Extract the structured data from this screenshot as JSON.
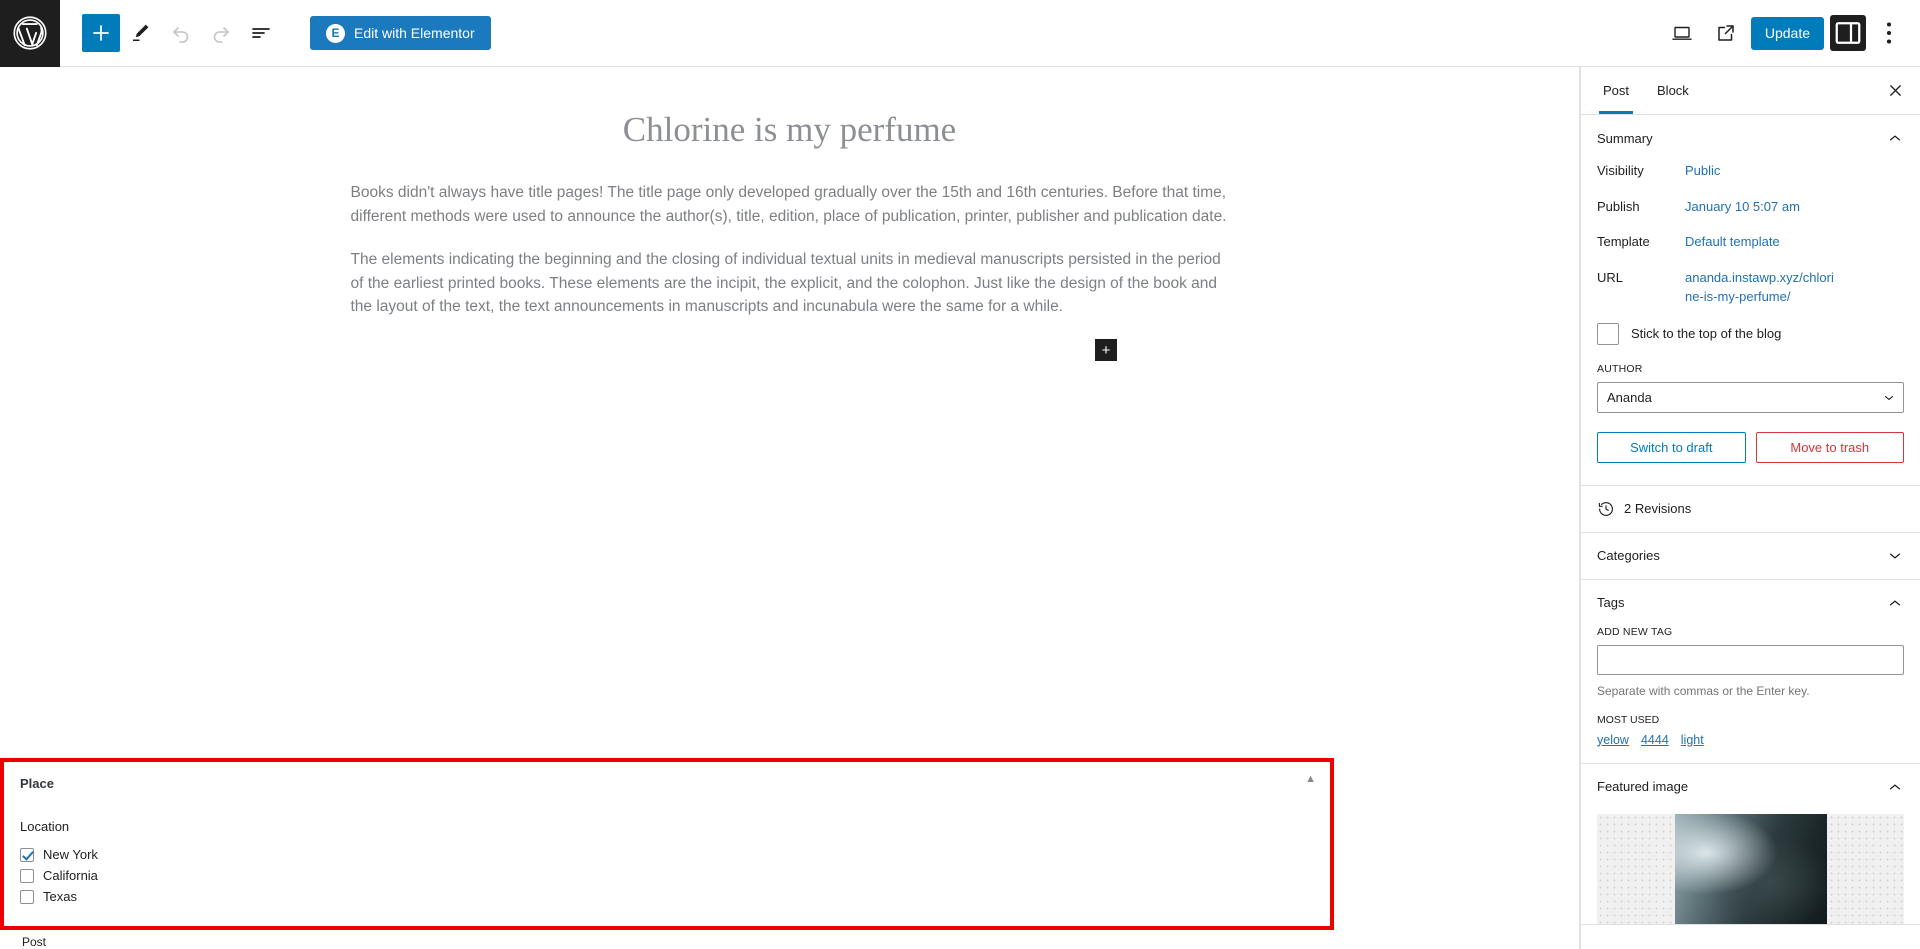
{
  "toolbar": {
    "logo_icon": "wordpress-logo-icon",
    "add_block_label": "+",
    "tools": [
      {
        "name": "add-block-button",
        "icon": "plus-icon"
      },
      {
        "name": "edit-tools-button",
        "icon": "pencil-icon"
      },
      {
        "name": "undo-button",
        "icon": "undo-arrow-icon"
      },
      {
        "name": "redo-button",
        "icon": "redo-arrow-icon"
      },
      {
        "name": "document-overview-button",
        "icon": "list-view-icon"
      }
    ],
    "elementor_label": "Edit with Elementor",
    "elementor_badge": "E",
    "preview_icon": "laptop-preview-icon",
    "view_icon": "external-link-icon",
    "update_label": "Update",
    "settings_icon": "sidebar-panel-icon",
    "options_icon": "more-options-icon"
  },
  "editor": {
    "title": "Chlorine is my perfume",
    "paragraph_1": "Books didn't always have title pages! The title page only developed gradually over the 15th and 16th centuries. Before that time, different methods were used to announce the author(s), title, edition, place of publication, printer, publisher and publication date.",
    "paragraph_2": "The elements indicating the beginning and the closing of individual textual units in medieval manuscripts persisted in the period of the earliest printed books. These elements are the incipit, the explicit, and the colophon. Just like the design of the book and the layout of the text, the text announcements in manuscripts and incunabula were the same for a while.",
    "inserter_label": "+"
  },
  "sidebar": {
    "tabs": [
      {
        "label": "Post",
        "active": true
      },
      {
        "label": "Block",
        "active": false
      }
    ],
    "close_icon": "close-icon",
    "summary": {
      "heading": "Summary",
      "rows": [
        {
          "label": "Visibility",
          "value": "Public"
        },
        {
          "label": "Publish",
          "value": "January 10 5:07 am"
        },
        {
          "label": "Template",
          "value": "Default template"
        },
        {
          "label": "URL",
          "value": "ananda.instawp.xyz/chlorine-is-my-perfume/"
        }
      ],
      "sticky_label": "Stick to the top of the blog",
      "sticky_checked": false,
      "author_label": "AUTHOR",
      "author_value": "Ananda",
      "author_options": [
        "Ananda"
      ],
      "switch_to_draft": "Switch to draft",
      "move_to_trash": "Move to trash"
    },
    "revisions": {
      "label": "2 Revisions",
      "icon": "revisions-clock-icon"
    },
    "categories": {
      "heading": "Categories",
      "expanded": false
    },
    "tags": {
      "heading": "Tags",
      "expanded": true,
      "add_new_label": "ADD NEW TAG",
      "input_value": "",
      "helper": "Separate with commas or the Enter key.",
      "most_used_label": "MOST USED",
      "most_used": [
        "yelow",
        "4444",
        "light"
      ]
    },
    "featured_image": {
      "heading": "Featured image",
      "expanded": true,
      "alt": "featured-image-thumbnail"
    }
  },
  "place_panel": {
    "title": "Place",
    "collapse_icon": "collapse-triangle-up-icon",
    "field_label": "Location",
    "options": [
      {
        "label": "New York",
        "checked": true
      },
      {
        "label": "California",
        "checked": false
      },
      {
        "label": "Texas",
        "checked": false
      }
    ],
    "highlight_color": "#ee0000"
  },
  "bottom_bar": {
    "breadcrumb": "Post"
  }
}
